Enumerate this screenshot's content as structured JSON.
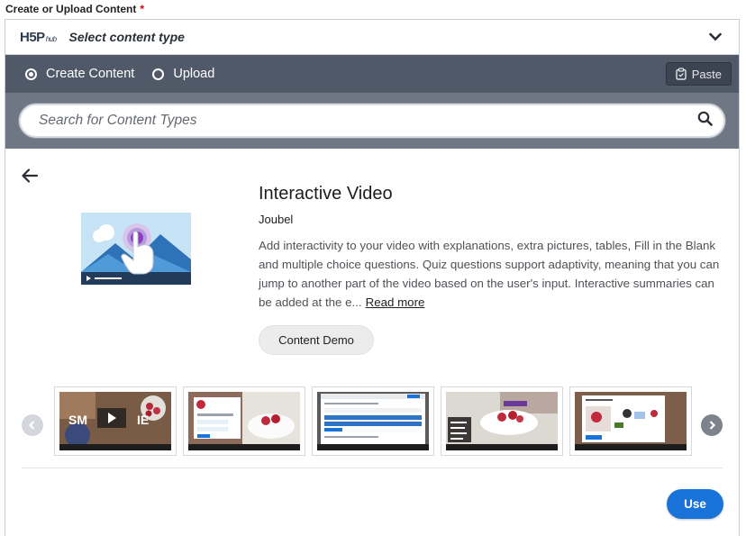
{
  "field": {
    "label": "Create or Upload Content",
    "required_mark": "*"
  },
  "hub": {
    "logo_text": "H5P",
    "logo_sub": "hub",
    "header_title": "Select content type"
  },
  "tabs": [
    {
      "label": "Create Content",
      "selected": true
    },
    {
      "label": "Upload",
      "selected": false
    }
  ],
  "paste": {
    "label": "Paste"
  },
  "search": {
    "placeholder": "Search for Content Types"
  },
  "content": {
    "title": "Interactive Video",
    "owner": "Joubel",
    "description": "Add interactivity to your video with explanations, extra pictures, tables, Fill in the Blank and multiple choice questions. Quiz questions support adaptivity, meaning that you can jump to another part of the video based on the user's input. Interactive summaries can be added at the e...",
    "read_more": "Read more",
    "demo_label": "Content Demo",
    "use_label": "Use"
  },
  "colors": {
    "tabs_bar": "#505968",
    "search_bar": "#6f7785",
    "accent": "#1a73d9"
  },
  "screenshots": [
    "smoothie-video",
    "question-overlay",
    "menu-list",
    "strawberry-bowl",
    "drag-and-drop"
  ]
}
